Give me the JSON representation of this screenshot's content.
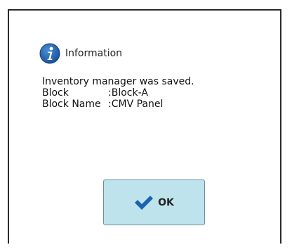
{
  "dialog": {
    "title": "Information",
    "message": {
      "line1": "Inventory manager was saved.",
      "block_label": "Block",
      "block_value": ":Block-A",
      "block_name_label": "Block Name",
      "block_name_value": ":CMV Panel"
    },
    "ok_label": "OK",
    "icons": {
      "info": "info-icon",
      "ok": "checkmark-icon"
    },
    "colors": {
      "info_icon": "#1f5fa8",
      "ok_button_bg": "#bfe3ec",
      "checkmark": "#1b63b0"
    }
  }
}
